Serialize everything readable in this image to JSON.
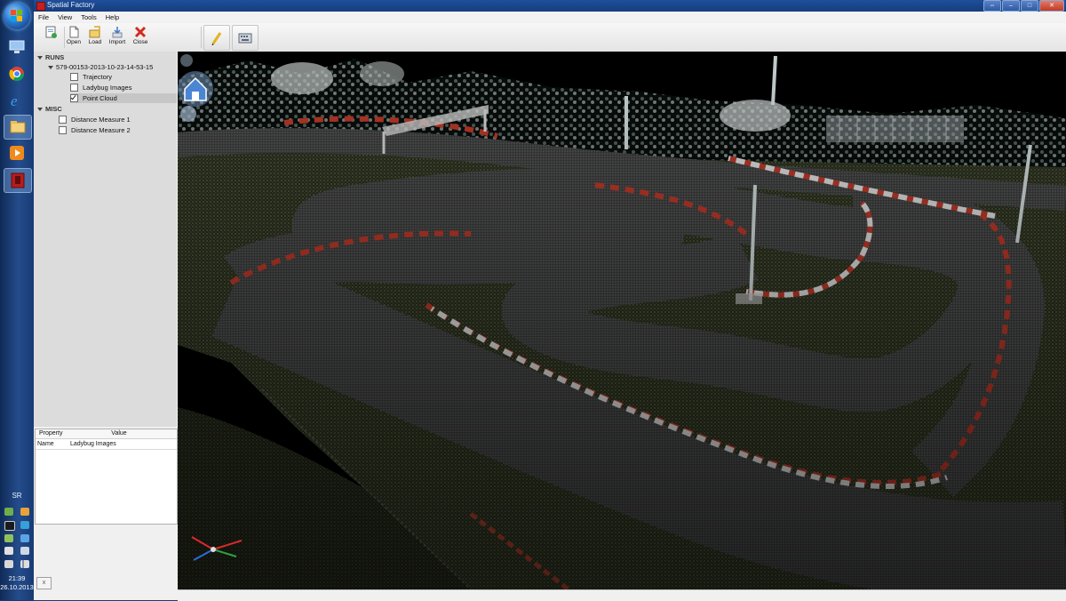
{
  "taskbar": {
    "language": "SR",
    "clock_time": "21:39",
    "clock_date": "26.10.2013"
  },
  "window": {
    "title": "Spatial Factory"
  },
  "menu": {
    "file": "File",
    "view": "View",
    "tools": "Tools",
    "help": "Help"
  },
  "toolbar": {
    "open": "Open",
    "load": "Load",
    "import": "Import",
    "close": "Close"
  },
  "tree": {
    "runs_header": "RUNS",
    "run_name": "579-00153-2013-10-23-14-53-15",
    "items": [
      {
        "label": "Trajectory",
        "checked": false
      },
      {
        "label": "Ladybug Images",
        "checked": false
      },
      {
        "label": "Point Cloud",
        "checked": true
      }
    ],
    "misc_header": "MISC",
    "misc_items": [
      {
        "label": "Distance Measure 1",
        "checked": false
      },
      {
        "label": "Distance Measure 2",
        "checked": false
      }
    ]
  },
  "properties": {
    "col_property": "Property",
    "col_value": "Value",
    "rows": [
      {
        "property": "Name",
        "value": "Ladybug Images"
      }
    ]
  },
  "bottom_panel": {
    "close_label": "x"
  }
}
